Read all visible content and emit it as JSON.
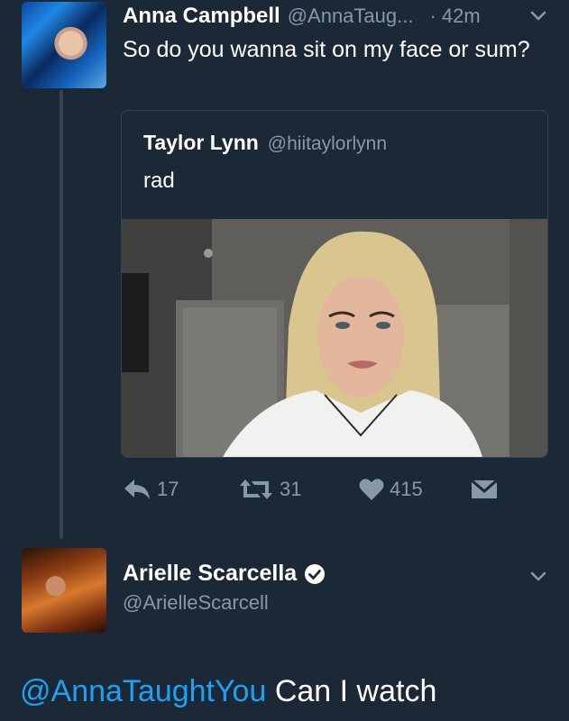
{
  "tweet1": {
    "author_name": "Anna Campbell",
    "author_handle": "@AnnaTaug...",
    "timestamp": "· 42m",
    "text": "So do you wanna sit on my face or sum?",
    "avatar_icon": "user-avatar-photo",
    "quote": {
      "author_name": "Taylor Lynn",
      "author_handle": "@hiitaylorlynn",
      "text": "rad",
      "media_icon": "embedded-photo"
    },
    "actions": {
      "reply_count": "17",
      "retweet_count": "31",
      "like_count": "415"
    }
  },
  "tweet2": {
    "author_name": "Arielle Scarcella",
    "author_handle": "@ArielleScarcell",
    "mention": "@AnnaTaughtYou",
    "text": " Can I watch",
    "avatar_icon": "user-avatar-photo",
    "verified_icon": "verified-badge-icon"
  },
  "colors": {
    "background": "#1b2836",
    "secondary_text": "#8899a6",
    "link": "#1da1f2",
    "border": "#38444d"
  }
}
